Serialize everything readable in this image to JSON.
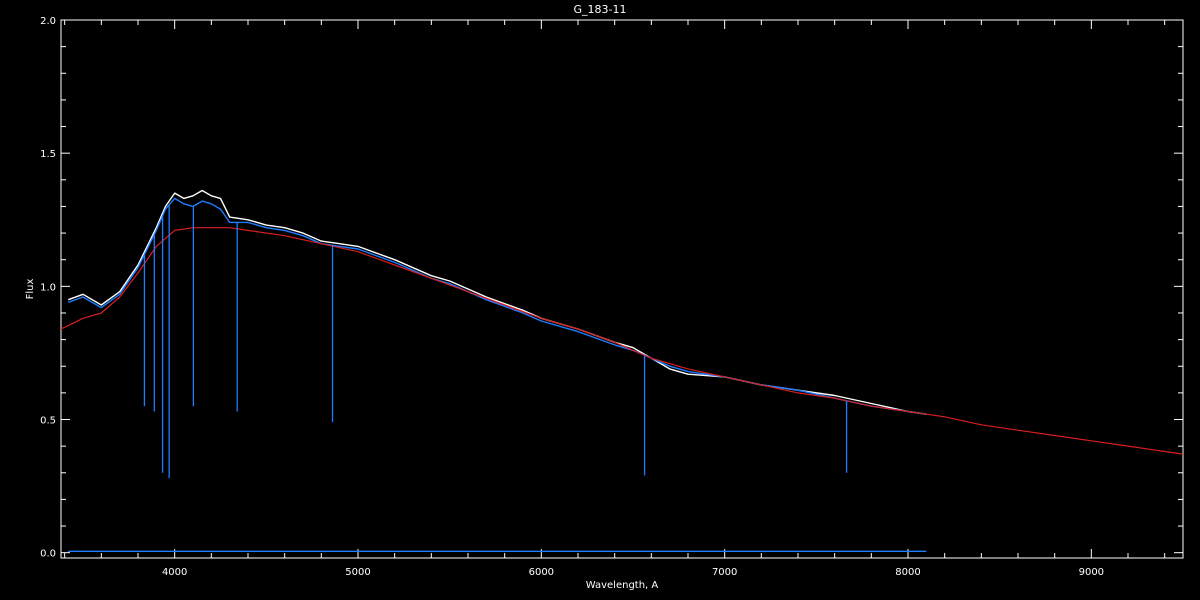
{
  "chart_data": {
    "type": "line",
    "title": "G_183-11",
    "xlabel": "Wavelength, A",
    "ylabel": "Flux",
    "xlim": [
      3380,
      9500
    ],
    "ylim": [
      -0.02,
      2.0
    ],
    "xticks": [
      4000,
      5000,
      6000,
      7000,
      8000,
      9000
    ],
    "xtick_labels": [
      "4000",
      "5000",
      "6000",
      "7000",
      "8000",
      "9000"
    ],
    "yticks": [
      0.0,
      0.5,
      1.0,
      1.5,
      2.0
    ],
    "ytick_labels": [
      "0.0",
      "0.5",
      "1.0",
      "1.5",
      "2.0"
    ],
    "grid": false,
    "background": "#000000",
    "series": [
      {
        "color": "#ffffff",
        "x": [
          3420,
          3500,
          3600,
          3700,
          3800,
          3900,
          3950,
          4000,
          4050,
          4100,
          4150,
          4200,
          4250,
          4300,
          4400,
          4500,
          4600,
          4700,
          4800,
          4900,
          5000,
          5200,
          5400,
          5500,
          5700,
          5900,
          6000,
          6200,
          6400,
          6500,
          6600,
          6700,
          6800,
          7000,
          7200,
          7400,
          7600,
          7800,
          8000,
          8100
        ],
        "y": [
          0.95,
          0.97,
          0.93,
          0.98,
          1.08,
          1.22,
          1.3,
          1.35,
          1.33,
          1.34,
          1.36,
          1.34,
          1.33,
          1.26,
          1.25,
          1.23,
          1.22,
          1.2,
          1.17,
          1.16,
          1.15,
          1.1,
          1.04,
          1.02,
          0.96,
          0.91,
          0.88,
          0.84,
          0.79,
          0.77,
          0.73,
          0.69,
          0.67,
          0.66,
          0.63,
          0.61,
          0.59,
          0.56,
          0.53,
          0.52
        ]
      },
      {
        "color": "#1e7dff",
        "x": [
          3420,
          3500,
          3600,
          3700,
          3800,
          3900,
          3950,
          4000,
          4050,
          4100,
          4150,
          4200,
          4250,
          4300,
          4400,
          4500,
          4600,
          4700,
          4800,
          4900,
          5000,
          5200,
          5400,
          5500,
          5700,
          5900,
          6000,
          6200,
          6400,
          6500,
          6600,
          6700,
          6800,
          7000,
          7200,
          7400,
          7600,
          7800,
          8000,
          8100
        ],
        "y": [
          0.94,
          0.96,
          0.92,
          0.97,
          1.07,
          1.21,
          1.29,
          1.33,
          1.31,
          1.3,
          1.32,
          1.31,
          1.29,
          1.24,
          1.24,
          1.22,
          1.21,
          1.19,
          1.16,
          1.15,
          1.14,
          1.09,
          1.03,
          1.01,
          0.95,
          0.9,
          0.87,
          0.83,
          0.78,
          0.76,
          0.73,
          0.7,
          0.68,
          0.66,
          0.63,
          0.61,
          0.58,
          0.55,
          0.53,
          0.52
        ]
      },
      {
        "color": "#d81e1e",
        "x": [
          3380,
          3500,
          3600,
          3700,
          3800,
          3900,
          4000,
          4100,
          4200,
          4300,
          4400,
          4600,
          4800,
          5000,
          5200,
          5400,
          5600,
          5800,
          6000,
          6200,
          6400,
          6600,
          6800,
          7000,
          7200,
          7400,
          7600,
          7800,
          8000,
          8200,
          8400,
          8600,
          8800,
          9000,
          9200,
          9400,
          9500
        ],
        "y": [
          0.84,
          0.88,
          0.9,
          0.96,
          1.05,
          1.15,
          1.21,
          1.22,
          1.22,
          1.22,
          1.21,
          1.19,
          1.16,
          1.13,
          1.08,
          1.03,
          0.98,
          0.93,
          0.88,
          0.84,
          0.79,
          0.73,
          0.69,
          0.66,
          0.63,
          0.6,
          0.58,
          0.55,
          0.53,
          0.51,
          0.48,
          0.46,
          0.44,
          0.42,
          0.4,
          0.38,
          0.37
        ]
      },
      {
        "color": "#1e7dff",
        "x": [
          3420,
          8100
        ],
        "y": [
          0.005,
          0.005
        ]
      }
    ],
    "absorption_lines": [
      {
        "x": 3835,
        "min": 0.55,
        "color": "#1e7dff"
      },
      {
        "x": 3889,
        "min": 0.53,
        "color": "#1e7dff"
      },
      {
        "x": 3934,
        "min": 0.3,
        "color": "#1e7dff"
      },
      {
        "x": 3970,
        "min": 0.28,
        "color": "#1e7dff"
      },
      {
        "x": 4102,
        "min": 0.55,
        "color": "#1e7dff"
      },
      {
        "x": 4341,
        "min": 0.53,
        "color": "#1e7dff"
      },
      {
        "x": 4861,
        "min": 0.49,
        "color": "#1e7dff"
      },
      {
        "x": 6563,
        "min": 0.29,
        "color": "#1e7dff"
      },
      {
        "x": 7665,
        "min": 0.3,
        "color": "#1e7dff"
      }
    ]
  }
}
